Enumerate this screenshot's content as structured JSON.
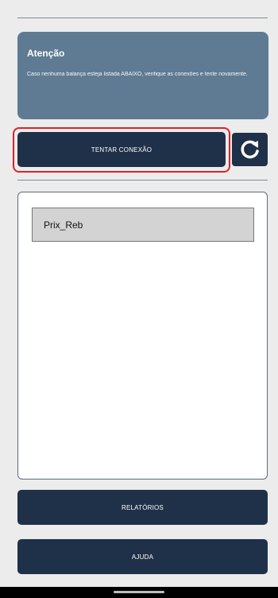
{
  "alert": {
    "title": "Atenção",
    "message": "Caso nenhuma balança esteja listada ABAIXO, verifique as conexões e tente novamente."
  },
  "actions": {
    "connect_label": "TENTAR CONEXÃO",
    "refresh_icon": "refresh-icon"
  },
  "devices": [
    {
      "name": "Prix_Reb"
    }
  ],
  "nav": {
    "reports_label": "RELATÓRIOS",
    "help_label": "AJUDA"
  },
  "colors": {
    "primary": "#1f3148",
    "alert_bg": "#5f7a93",
    "highlight": "#e0202a",
    "background": "#ececec"
  }
}
